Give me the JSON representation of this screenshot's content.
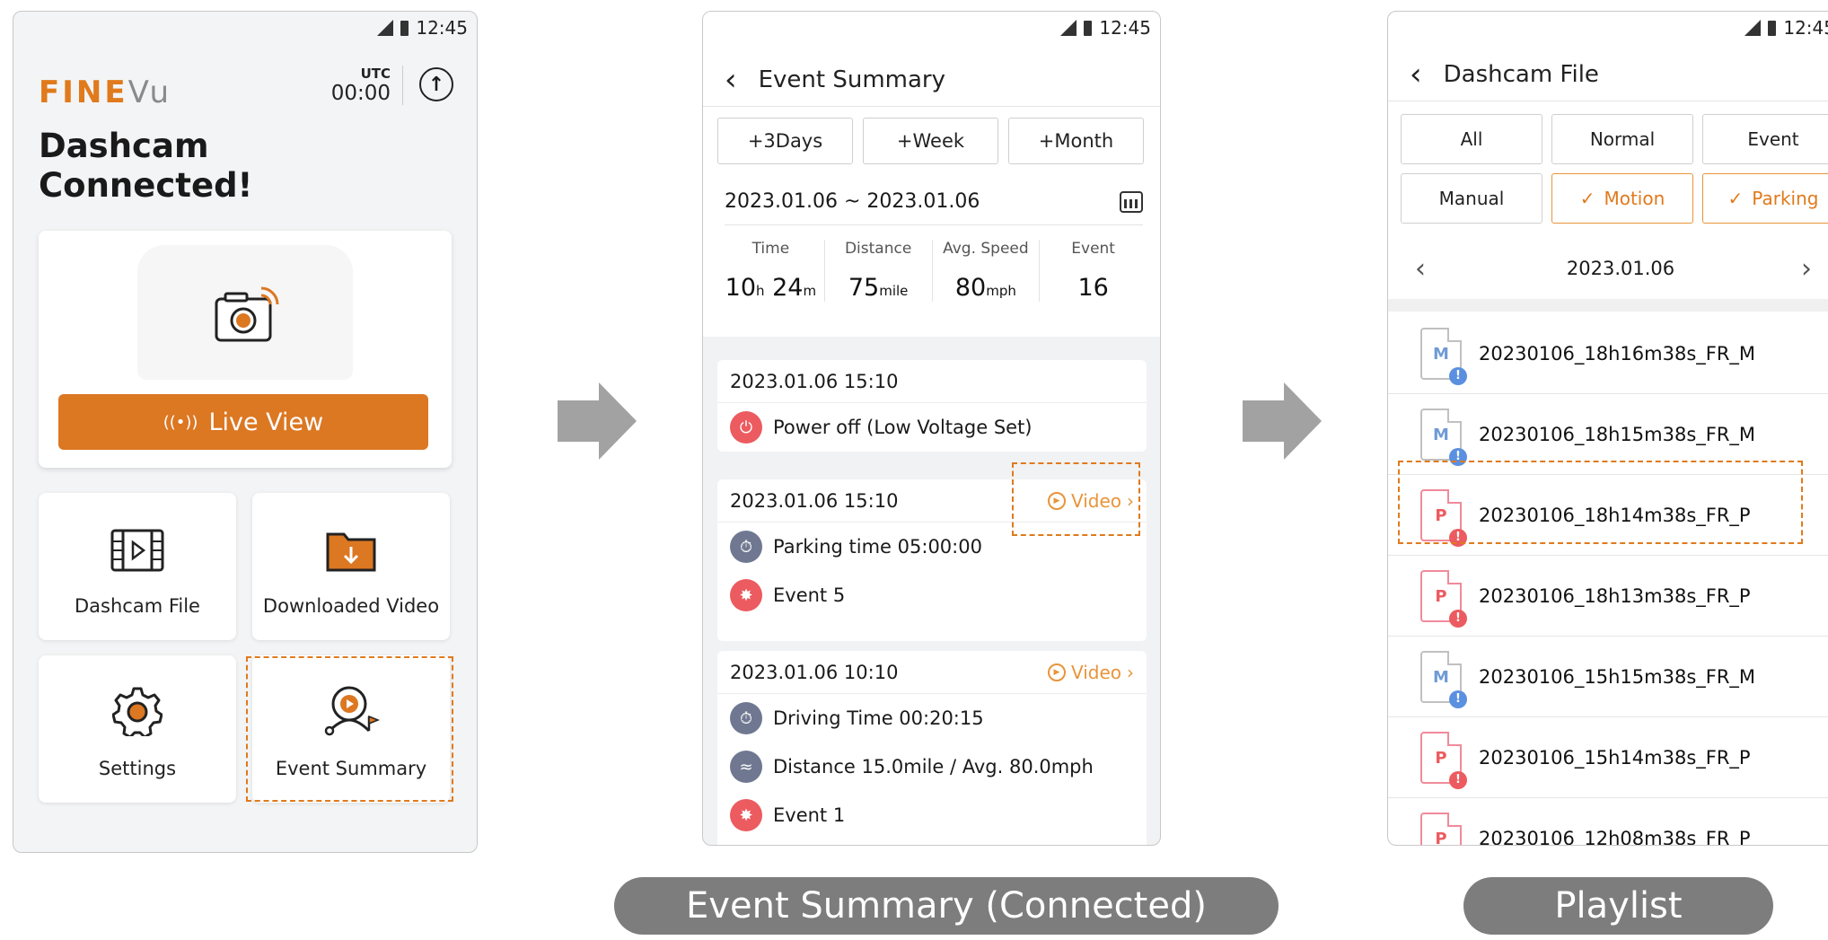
{
  "phone1": {
    "status_time": "12:45",
    "logo_fine": "FINE",
    "logo_vu": "Vu",
    "utc_label": "UTC",
    "utc_time": "00:00",
    "headline_line1": "Dashcam",
    "headline_line2": "Connected!",
    "live_view_label": "Live View",
    "tiles": [
      {
        "label": "Dashcam File"
      },
      {
        "label": "Downloaded Video"
      },
      {
        "label": "Settings"
      },
      {
        "label": "Event Summary"
      }
    ]
  },
  "phone2": {
    "status_time": "12:45",
    "title": "Event Summary",
    "range_buttons": [
      "+3Days",
      "+Week",
      "+Month"
    ],
    "date_range": "2023.01.06 ~ 2023.01.06",
    "stats": {
      "time_header": "Time",
      "distance_header": "Distance",
      "speed_header": "Avg. Speed",
      "event_header": "Event",
      "time_h": "10",
      "time_h_unit": "h",
      "time_m": "24",
      "time_m_unit": "m",
      "distance": "75",
      "distance_unit": "mile",
      "speed": "80",
      "speed_unit": "mph",
      "events": "16"
    },
    "cards": [
      {
        "datetime": "2023.01.06 15:10",
        "rows": [
          "Power off (Low Voltage Set)"
        ]
      },
      {
        "datetime": "2023.01.06 15:10",
        "video": "Video",
        "rows": [
          "Parking time  05:00:00",
          "Event  5"
        ]
      },
      {
        "datetime": "2023.01.06 10:10",
        "video": "Video",
        "rows": [
          "Driving Time  00:20:15",
          "Distance 15.0mile / Avg. 80.0mph",
          "Event  1"
        ]
      }
    ]
  },
  "phone3": {
    "status_time": "12:45",
    "title": "Dashcam File",
    "filters_row1": [
      "All",
      "Normal",
      "Event"
    ],
    "filters_row2": [
      "Manual",
      "Motion",
      "Parking"
    ],
    "date": "2023.01.06",
    "files": [
      {
        "type": "M",
        "name": "20230106_18h16m38s_FR_M"
      },
      {
        "type": "M",
        "name": "20230106_18h15m38s_FR_M"
      },
      {
        "type": "P",
        "name": "20230106_18h14m38s_FR_P"
      },
      {
        "type": "P",
        "name": "20230106_18h13m38s_FR_P"
      },
      {
        "type": "M",
        "name": "20230106_15h15m38s_FR_M"
      },
      {
        "type": "P",
        "name": "20230106_15h14m38s_FR_P"
      },
      {
        "type": "P",
        "name": "20230106_12h08m38s_FR_P"
      }
    ]
  },
  "captions": {
    "event_summary": "Event Summary (Connected)",
    "playlist": "Playlist"
  },
  "colors": {
    "accent_orange": "#dc7722",
    "event_red": "#eb5b5f",
    "manual_blue": "#5b90e0",
    "caption_gray": "#7d7d7d"
  }
}
